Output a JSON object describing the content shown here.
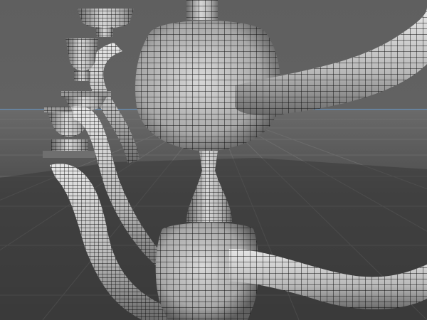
{
  "viewport": {
    "colors": {
      "background": "#5f5f5f",
      "horizon_line": "#6b8fb3",
      "floor_grid": "#7a7a7a",
      "mesh_light": "#d2d2d2",
      "mesh_mid": "#a8a8a8",
      "mesh_dark": "#2a2a2a",
      "wireframe": "#111111"
    },
    "object": "candelabra-mesh"
  }
}
